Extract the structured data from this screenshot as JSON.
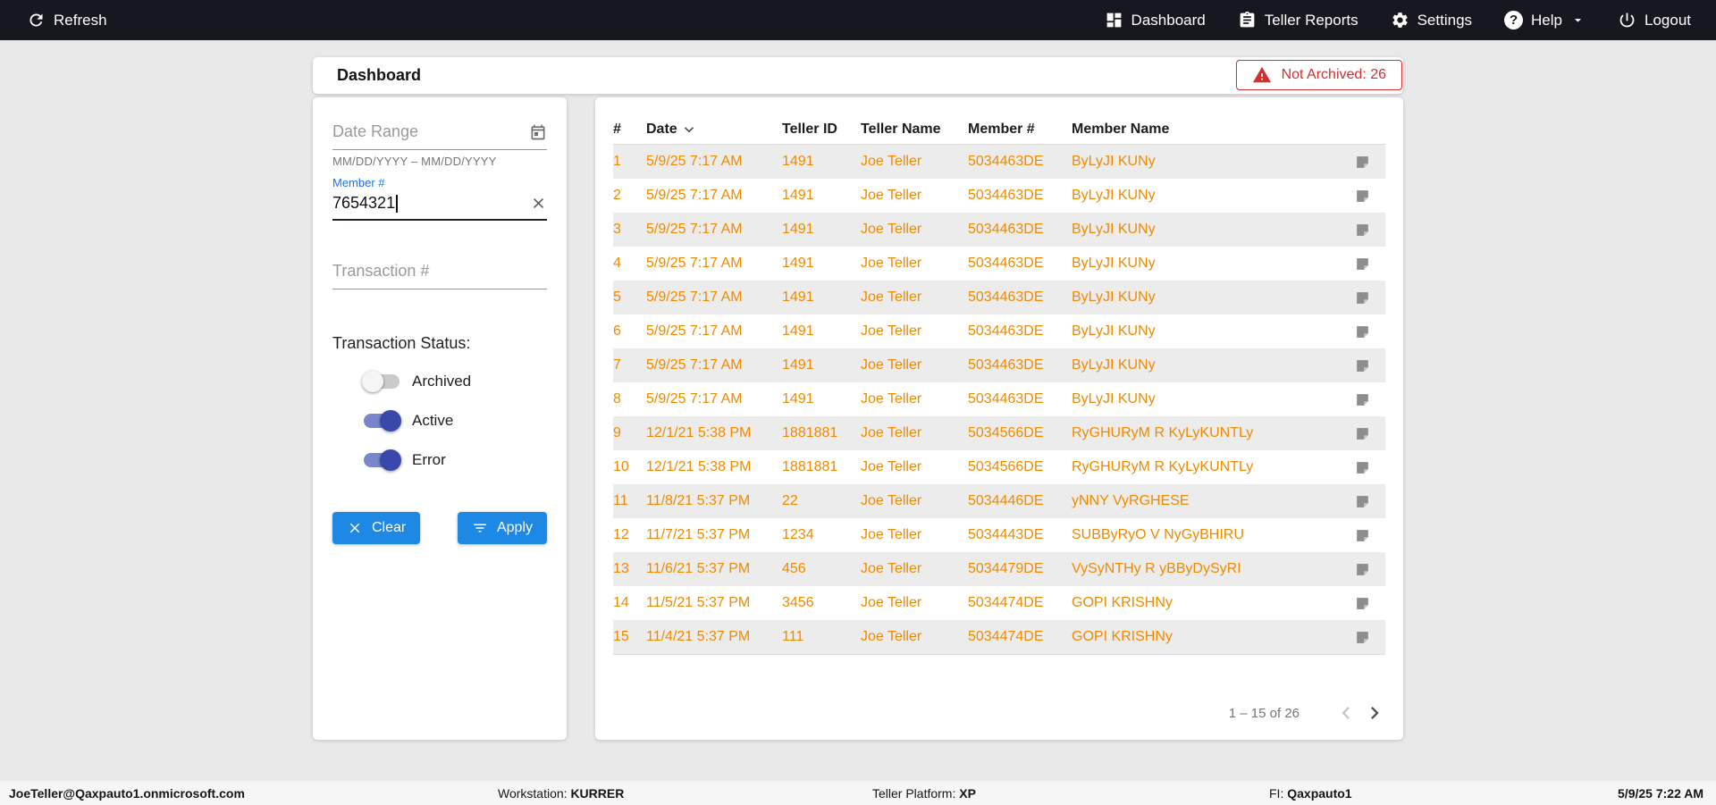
{
  "topbar": {
    "refresh_label": "Refresh",
    "items": [
      {
        "label": "Dashboard",
        "icon": "dashboard-icon"
      },
      {
        "label": "Teller Reports",
        "icon": "reports-icon"
      },
      {
        "label": "Settings",
        "icon": "gear-icon"
      },
      {
        "label": "Help",
        "icon": "help-icon"
      },
      {
        "label": "Logout",
        "icon": "power-icon"
      }
    ]
  },
  "header": {
    "title": "Dashboard",
    "badge_label": "Not Archived: 26"
  },
  "filters": {
    "date_range": {
      "placeholder": "Date Range",
      "helper": "MM/DD/YYYY – MM/DD/YYYY"
    },
    "member": {
      "label": "Member #",
      "value": "7654321"
    },
    "transaction": {
      "placeholder": "Transaction #"
    },
    "status_label": "Transaction Status:",
    "toggles": [
      {
        "label": "Archived",
        "on": false
      },
      {
        "label": "Active",
        "on": true
      },
      {
        "label": "Error",
        "on": true
      }
    ],
    "clear_label": "Clear",
    "apply_label": "Apply"
  },
  "table": {
    "columns": [
      "#",
      "Date",
      "Teller ID",
      "Teller Name",
      "Member #",
      "Member Name"
    ],
    "rows": [
      {
        "num": "1",
        "date": "5/9/25 7:17 AM",
        "teller_id": "1491",
        "teller_name": "Joe Teller",
        "member": "5034463DE",
        "member_name": "ByLyJI KUNy"
      },
      {
        "num": "2",
        "date": "5/9/25 7:17 AM",
        "teller_id": "1491",
        "teller_name": "Joe Teller",
        "member": "5034463DE",
        "member_name": "ByLyJI KUNy"
      },
      {
        "num": "3",
        "date": "5/9/25 7:17 AM",
        "teller_id": "1491",
        "teller_name": "Joe Teller",
        "member": "5034463DE",
        "member_name": "ByLyJI KUNy"
      },
      {
        "num": "4",
        "date": "5/9/25 7:17 AM",
        "teller_id": "1491",
        "teller_name": "Joe Teller",
        "member": "5034463DE",
        "member_name": "ByLyJI KUNy"
      },
      {
        "num": "5",
        "date": "5/9/25 7:17 AM",
        "teller_id": "1491",
        "teller_name": "Joe Teller",
        "member": "5034463DE",
        "member_name": "ByLyJI KUNy"
      },
      {
        "num": "6",
        "date": "5/9/25 7:17 AM",
        "teller_id": "1491",
        "teller_name": "Joe Teller",
        "member": "5034463DE",
        "member_name": "ByLyJI KUNy"
      },
      {
        "num": "7",
        "date": "5/9/25 7:17 AM",
        "teller_id": "1491",
        "teller_name": "Joe Teller",
        "member": "5034463DE",
        "member_name": "ByLyJI KUNy"
      },
      {
        "num": "8",
        "date": "5/9/25 7:17 AM",
        "teller_id": "1491",
        "teller_name": "Joe Teller",
        "member": "5034463DE",
        "member_name": "ByLyJI KUNy"
      },
      {
        "num": "9",
        "date": "12/1/21 5:38 PM",
        "teller_id": "1881881",
        "teller_name": "Joe Teller",
        "member": "5034566DE",
        "member_name": "RyGHURyM R KyLyKUNTLy"
      },
      {
        "num": "10",
        "date": "12/1/21 5:38 PM",
        "teller_id": "1881881",
        "teller_name": "Joe Teller",
        "member": "5034566DE",
        "member_name": "RyGHURyM R KyLyKUNTLy"
      },
      {
        "num": "11",
        "date": "11/8/21 5:37 PM",
        "teller_id": "22",
        "teller_name": "Joe Teller",
        "member": "5034446DE",
        "member_name": "yNNY VyRGHESE"
      },
      {
        "num": "12",
        "date": "11/7/21 5:37 PM",
        "teller_id": "1234",
        "teller_name": "Joe Teller",
        "member": "5034443DE",
        "member_name": "SUBByRyO V NyGyBHIRU"
      },
      {
        "num": "13",
        "date": "11/6/21 5:37 PM",
        "teller_id": "456",
        "teller_name": "Joe Teller",
        "member": "5034479DE",
        "member_name": "VySyNTHy R yBByDySyRI"
      },
      {
        "num": "14",
        "date": "11/5/21 5:37 PM",
        "teller_id": "3456",
        "teller_name": "Joe Teller",
        "member": "5034474DE",
        "member_name": "GOPI KRISHNy"
      },
      {
        "num": "15",
        "date": "11/4/21 5:37 PM",
        "teller_id": "111",
        "teller_name": "Joe Teller",
        "member": "5034474DE",
        "member_name": "GOPI KRISHNy"
      }
    ],
    "pagination": {
      "range": "1 – 15 of 26"
    }
  },
  "footer": {
    "user": "JoeTeller@Qaxpauto1.onmicrosoft.com",
    "workstation_label": "Workstation: ",
    "workstation_value": "KURRER",
    "platform_label": "Teller Platform: ",
    "platform_value": "XP",
    "fi_label": "FI: ",
    "fi_value": "Qaxpauto1",
    "datetime": "5/9/25 7:22 AM"
  },
  "colors": {
    "topbar": "#17171F",
    "accent_blue": "#1E88E5",
    "row_orange": "#EF8A00",
    "alert_red": "#D32F2F",
    "toggle_on": "#3949AB",
    "member_label_blue": "#1A73E8"
  }
}
